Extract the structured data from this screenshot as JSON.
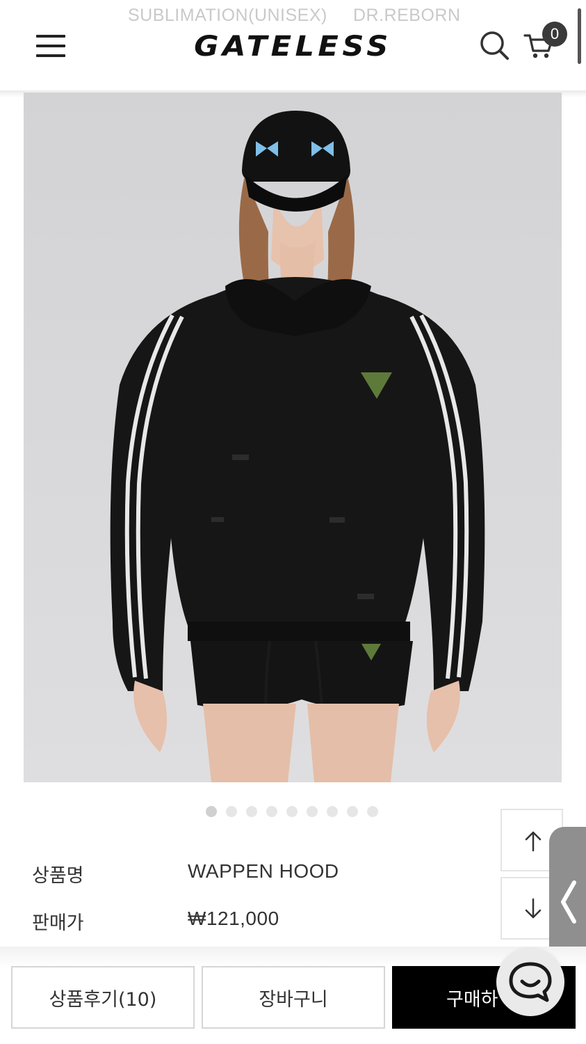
{
  "top_links": [
    "SUBLIMATION(UNISEX)",
    "DR.REBORN"
  ],
  "header": {
    "logo": "GATELESS",
    "cart_count": "0",
    "icons": [
      "menu-icon",
      "search-icon",
      "cart-icon"
    ]
  },
  "carousel": {
    "total": 9,
    "active": 1
  },
  "product": {
    "name_label": "상품명",
    "name_value": "WAPPEN HOOD",
    "price_label": "판매가",
    "price_value": "₩121,000"
  },
  "bottom_bar": {
    "review_label": "상품후기(10)",
    "cart_label": "장바구니",
    "buy_label": "구매하"
  },
  "colors": {
    "accent": "#000000",
    "badge": "#3a3a3a",
    "side_tab": "#8f8f8f"
  }
}
